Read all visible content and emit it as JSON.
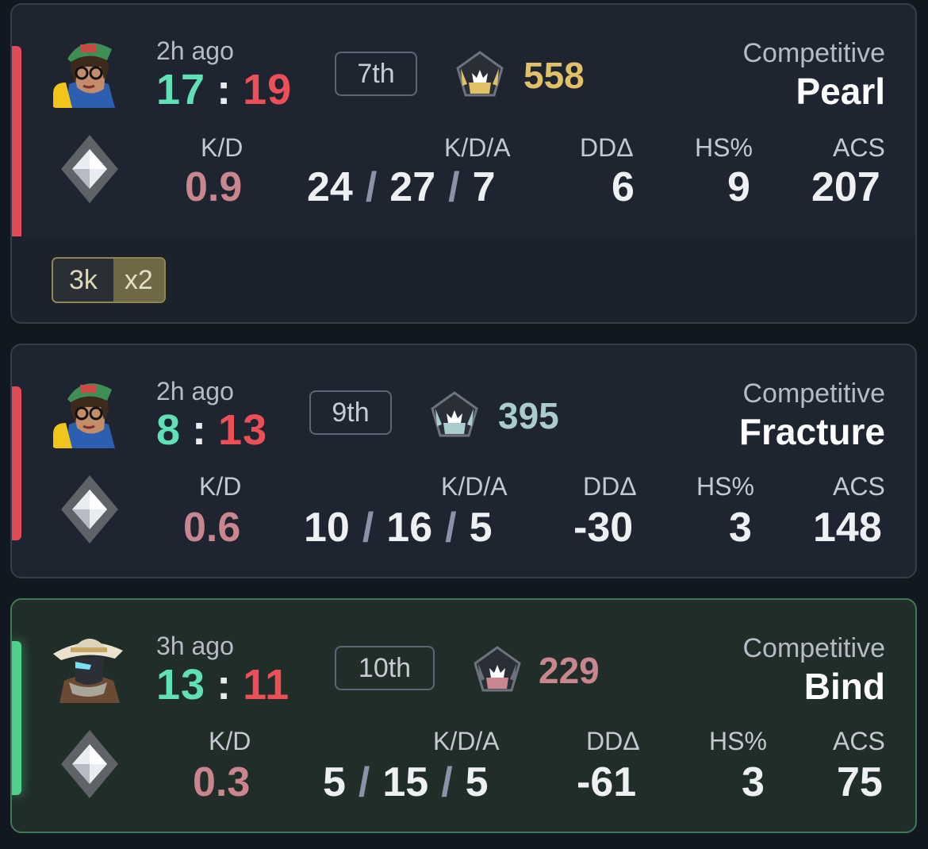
{
  "matches": [
    {
      "time_ago": "2h ago",
      "score_won": "17",
      "score_sep": ":",
      "score_lost": "19",
      "placement": "7th",
      "rr_value": "558",
      "rr_color": "#e2c067",
      "mode": "Competitive",
      "map": "Pearl",
      "result": "loss",
      "agent_icon": "agent-killjoy-portrait",
      "rank_icon": "silver-rank-diamond",
      "labels": {
        "kd": "K/D",
        "kda": "K/D/A",
        "dd": "DDΔ",
        "hs": "HS%",
        "acs": "ACS"
      },
      "stats": {
        "kd": "0.9",
        "kills": "24",
        "deaths": "27",
        "assists": "7",
        "kda_sep": "/",
        "dd": "6",
        "hs": "9",
        "acs": "207"
      },
      "multikill": {
        "label": "3k",
        "count": "x2"
      }
    },
    {
      "time_ago": "2h ago",
      "score_won": "8",
      "score_sep": ":",
      "score_lost": "13",
      "placement": "9th",
      "rr_value": "395",
      "rr_color": "#a9cccf",
      "mode": "Competitive",
      "map": "Fracture",
      "result": "loss",
      "agent_icon": "agent-killjoy-portrait",
      "rank_icon": "silver-rank-diamond",
      "labels": {
        "kd": "K/D",
        "kda": "K/D/A",
        "dd": "DDΔ",
        "hs": "HS%",
        "acs": "ACS"
      },
      "stats": {
        "kd": "0.6",
        "kills": "10",
        "deaths": "16",
        "assists": "5",
        "kda_sep": "/",
        "dd": "-30",
        "hs": "3",
        "acs": "148"
      }
    },
    {
      "time_ago": "3h ago",
      "score_won": "13",
      "score_sep": ":",
      "score_lost": "11",
      "placement": "10th",
      "rr_value": "229",
      "rr_color": "#c8868e",
      "mode": "Competitive",
      "map": "Bind",
      "result": "win",
      "agent_icon": "agent-chamber-portrait",
      "rank_icon": "silver-rank-diamond",
      "labels": {
        "kd": "K/D",
        "kda": "K/D/A",
        "dd": "DDΔ",
        "hs": "HS%",
        "acs": "ACS"
      },
      "stats": {
        "kd": "0.3",
        "kills": "5",
        "deaths": "15",
        "assists": "5",
        "kda_sep": "/",
        "dd": "-61",
        "hs": "3",
        "acs": "75"
      }
    }
  ]
}
